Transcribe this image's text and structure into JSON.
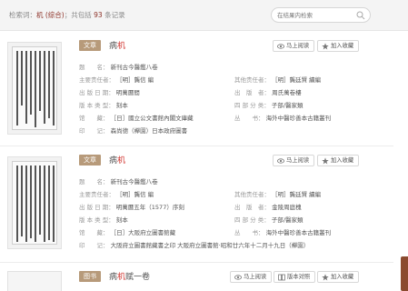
{
  "header": {
    "summary_prefix": "检索词：",
    "keyword": "机 (综合)",
    "summary_mid": "；共包括",
    "count": "93",
    "summary_suffix": "条记录",
    "search_placeholder": "在结果内检索"
  },
  "buttons": {
    "read": "马上阅读",
    "collect": "加入收藏",
    "compare": "版本对照"
  },
  "labels": {
    "title_label": "题　　名：",
    "main_resp": "主要责任者：",
    "other_resp": "其他责任者：",
    "pub_date": "出 版 日 期：",
    "publisher": "出　版　者：",
    "edition": "版 本 类 型：",
    "category": "四 部 分 类：",
    "holdings": "馆　　藏：",
    "series": "丛　　书：",
    "seal": "印　　记："
  },
  "records": [
    {
      "type": "文章",
      "title_hl": "机",
      "title_pre": "病",
      "title_post": "",
      "title": "新刊古今醫鑑八卷",
      "main_resp": "［明］龔信 編",
      "other_resp": "［明］龔廷賢 續編",
      "pub_date": "明萬曆間",
      "publisher": "周氏萬卷樓",
      "edition": "刻本",
      "category": "子部/醫家類",
      "holdings": "［日］國立公文書館內閣文庫藏",
      "series": "海外中醫珍善本古籍叢刊",
      "seal": "森尚德（櫸園）日本政府圖書"
    },
    {
      "type": "文章",
      "title_hl": "机",
      "title_pre": "病",
      "title_post": "",
      "title": "新刊古今醫鑑八卷",
      "main_resp": "［明］龔信 編",
      "other_resp": "［明］龔廷賢 續編",
      "pub_date": "明萬曆五年（1577）序刻",
      "publisher": "金陵周庭槐",
      "edition": "刻本",
      "category": "子部/醫家類",
      "holdings": "［日］大阪府立圖書館藏",
      "series": "海外中醫珍善本古籍叢刊",
      "seal": "大阪府立圖書館藏書之印 大阪府立圖書館·昭和廿六年十二月十九日（櫸園）"
    },
    {
      "type": "图书",
      "title_hl": "机",
      "title_pre": "病",
      "title_post": "赋一卷"
    }
  ]
}
